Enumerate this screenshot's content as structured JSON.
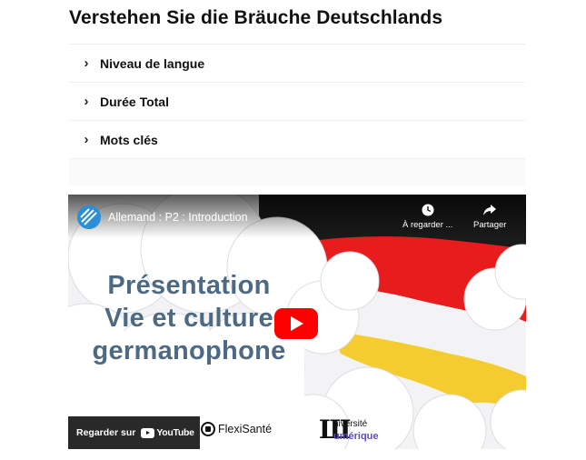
{
  "page": {
    "title": "Verstehen Sie die Bräuche Deutschlands"
  },
  "accordion": {
    "items": [
      {
        "label": "Niveau de langue",
        "icon": "chevron-right-icon"
      },
      {
        "label": "Durée Total",
        "icon": "chevron-right-icon"
      },
      {
        "label": "Mots clés",
        "icon": "chevron-right-icon"
      }
    ],
    "chevron_glyph": "›"
  },
  "video": {
    "title": "Allemand : P2 : Introduction",
    "watch_later_label": "À regarder ...",
    "share_label": "Partager",
    "slide_lines": [
      "Présentation",
      "Vie et culture",
      "germanophone"
    ],
    "watch_on_label": "Regarder sur",
    "youtube_word": "YouTube",
    "sponsor": "FlexiSanté",
    "university_line1": "niversité",
    "university_line2": "umérique",
    "colors": {
      "slide_text": "#4d6a82",
      "flag_red": "#e81c1c",
      "flag_yellow": "#f4cc2f",
      "flag_black": "#1a1a1a",
      "play_red": "#ff0000",
      "channel_blue": "#2a8fd6",
      "university_accent": "#5b4dbb"
    }
  }
}
